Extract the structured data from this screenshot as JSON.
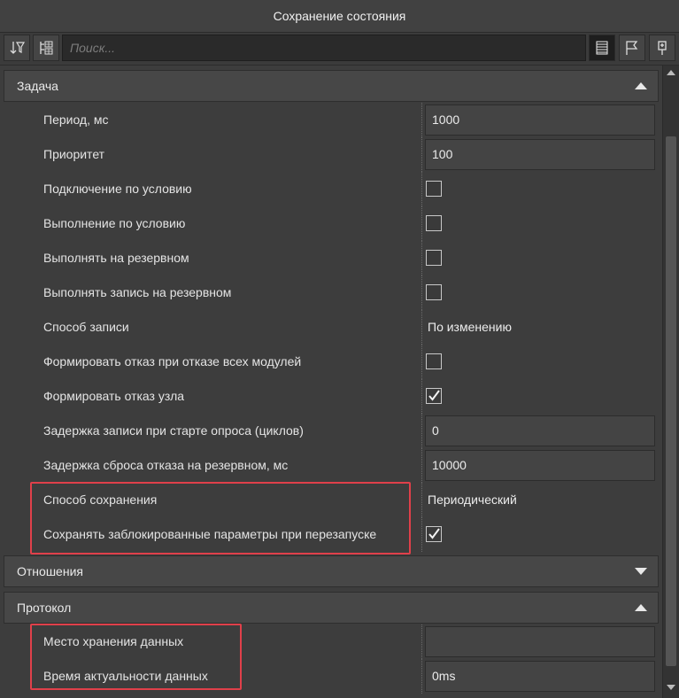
{
  "window": {
    "title": "Сохранение состояния"
  },
  "toolbar": {
    "search_placeholder": "Поиск...",
    "buttons": [
      "sort-filter-icon",
      "group-icon",
      "list-view-icon",
      "flag-icon",
      "pin-icon"
    ]
  },
  "groups": {
    "task": {
      "title": "Задача",
      "expanded": true,
      "rows": [
        {
          "label": "Период, мс",
          "type": "input",
          "value": "1000"
        },
        {
          "label": "Приоритет",
          "type": "input",
          "value": "100"
        },
        {
          "label": "Подключение по условию",
          "type": "checkbox",
          "checked": false
        },
        {
          "label": "Выполнение по условию",
          "type": "checkbox",
          "checked": false
        },
        {
          "label": "Выполнять на резервном",
          "type": "checkbox",
          "checked": false
        },
        {
          "label": "Выполнять запись на резервном",
          "type": "checkbox",
          "checked": false
        },
        {
          "label": "Способ записи",
          "type": "text",
          "value": "По изменению"
        },
        {
          "label": "Формировать отказ при отказе всех модулей",
          "type": "checkbox",
          "checked": false
        },
        {
          "label": "Формировать отказ узла",
          "type": "checkbox",
          "checked": true
        },
        {
          "label": "Задержка записи при старте опроса (циклов)",
          "type": "input",
          "value": "0"
        },
        {
          "label": "Задержка сброса отказа на резервном, мс",
          "type": "input",
          "value": "10000"
        },
        {
          "label": "Способ сохранения",
          "type": "text",
          "value": "Периодический"
        },
        {
          "label": "Сохранять заблокированные параметры при перезапуске",
          "type": "checkbox",
          "checked": true
        }
      ]
    },
    "relations": {
      "title": "Отношения",
      "expanded": false
    },
    "protocol": {
      "title": "Протокол",
      "expanded": true,
      "rows": [
        {
          "label": "Место хранения данных",
          "type": "input",
          "value": ""
        },
        {
          "label": "Время актуальности данных",
          "type": "input",
          "value": "0ms"
        }
      ]
    }
  },
  "colors": {
    "highlight": "#e0404a",
    "background": "#3a3a3a"
  }
}
